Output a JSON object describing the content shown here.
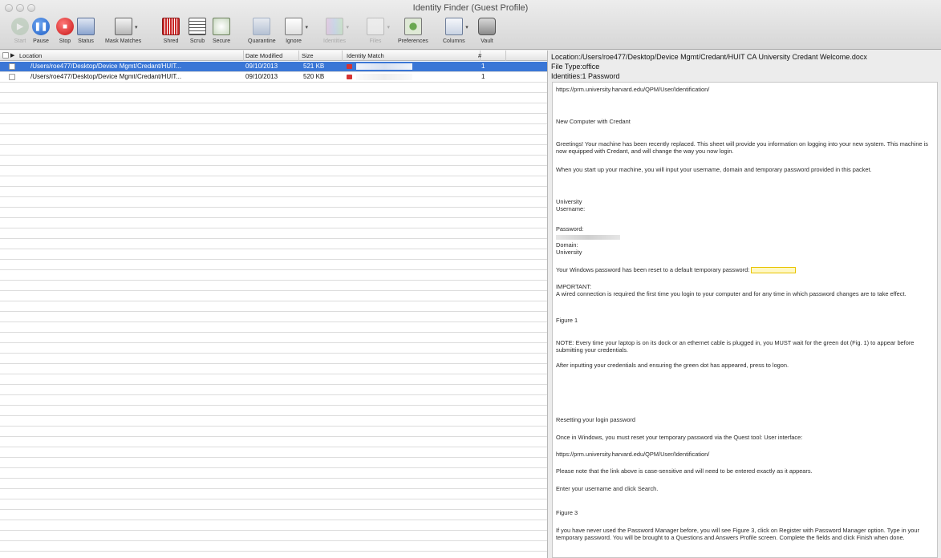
{
  "window": {
    "title": "Identity Finder (Guest Profile)"
  },
  "toolbar": {
    "items": [
      {
        "label": "Start",
        "icon": "play-icon",
        "enabled": false
      },
      {
        "label": "Pause",
        "icon": "pause-icon",
        "enabled": true
      },
      {
        "label": "Stop",
        "icon": "stop-icon",
        "enabled": true
      },
      {
        "label": "Status",
        "icon": "status-icon",
        "enabled": true
      },
      {
        "label": "Mask Matches",
        "icon": "mask-matches-icon",
        "enabled": true
      },
      {
        "label": "Shred",
        "icon": "shred-icon",
        "enabled": true
      },
      {
        "label": "Scrub",
        "icon": "scrub-icon",
        "enabled": true
      },
      {
        "label": "Secure",
        "icon": "secure-icon",
        "enabled": true
      },
      {
        "label": "Quarantine",
        "icon": "quarantine-icon",
        "enabled": true
      },
      {
        "label": "Ignore",
        "icon": "ignore-icon",
        "enabled": true
      },
      {
        "label": "Identities",
        "icon": "identities-icon",
        "enabled": false
      },
      {
        "label": "Files",
        "icon": "files-icon",
        "enabled": false
      },
      {
        "label": "Preferences",
        "icon": "preferences-icon",
        "enabled": true
      },
      {
        "label": "Columns",
        "icon": "columns-icon",
        "enabled": true
      },
      {
        "label": "Vault",
        "icon": "vault-icon",
        "enabled": true
      }
    ]
  },
  "list": {
    "columns": {
      "location": "Location",
      "date_modified": "Date Modified",
      "size": "Size",
      "identity_match": "Identity Match",
      "count": "#"
    },
    "rows": [
      {
        "location": "/Users/roe477/Desktop/Device Mgmt/Credant/HUIT...",
        "date": "09/10/2013",
        "size": "521 KB",
        "count": "1",
        "selected": true
      },
      {
        "location": "/Users/roe477/Desktop/Device Mgmt/Credant/HUIT...",
        "date": "09/10/2013",
        "size": "520 KB",
        "count": "1",
        "selected": false
      }
    ]
  },
  "preview": {
    "location": "Location:/Users/roe477/Desktop/Device Mgmt/Credant/HUIT CA University Credant Welcome.docx",
    "file_type": "File Type:office",
    "identities": "Identities:1 Password",
    "doc": {
      "url1": "https://prm.university.harvard.edu/QPM/User/Identification/",
      "heading1": "New Computer with Credant",
      "para1": "Greetings!  Your machine has been recently replaced. This sheet will provide you information on logging into your new system. This machine is now equipped with Credant, and will change the way you now login.",
      "para2": "When you start up your machine, you will input your username, domain and temporary password provided in this packet.",
      "university1": "University",
      "username": "Username:",
      "password": "Password:",
      "domain": "Domain:",
      "university2": "University",
      "reset_text": "Your Windows password has been reset to a default temporary password:",
      "important": "IMPORTANT:",
      "para3": "A wired connection is required the first time you login to your computer and for any time in which password changes are to take effect.",
      "figure1": "Figure 1",
      "note": "NOTE: Every time your laptop is on its dock or an ethernet cable is plugged in, you MUST wait for the green dot (Fig. 1) to appear before submitting your credentials.",
      "after": "After inputting your credentials and ensuring the green dot has appeared, press  to logon.",
      "resetting": "Resetting your login password",
      "once": "Once in Windows, you must reset your temporary password via the Quest tool: User interface:",
      "url2": "https://prm.university.harvard.edu/QPM/User/Identification/",
      "note2": "Please note that the link above is case-sensitive and will need to be entered exactly as it appears.",
      "enter": "Enter your username and click Search.",
      "figure3": "Figure 3",
      "para4": "If you have never used the Password Manager before, you will see Figure 3, click on Register with Password Manager option.  Type in your temporary password.  You will be brought to a Questions and Answers Profile screen.  Complete the fields and click Finish when done."
    }
  }
}
